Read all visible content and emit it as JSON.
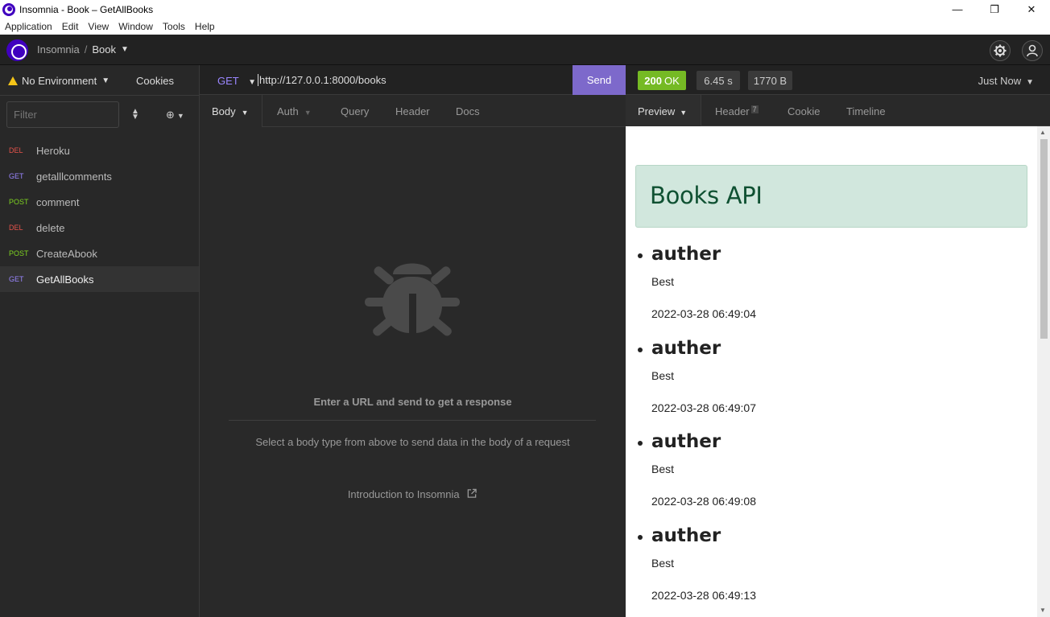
{
  "window": {
    "title": "Insomnia - Book – GetAllBooks",
    "controls": [
      "—",
      "❐",
      "✕"
    ]
  },
  "menu": [
    "Application",
    "Edit",
    "View",
    "Window",
    "Tools",
    "Help"
  ],
  "header": {
    "workspace": "Insomnia",
    "separator": "/",
    "collection": "Book"
  },
  "sidebar": {
    "environment": "No Environment",
    "cookies": "Cookies",
    "filter_placeholder": "Filter",
    "requests": [
      {
        "method": "DEL",
        "name": "Heroku"
      },
      {
        "method": "GET",
        "name": "getalllcomments"
      },
      {
        "method": "POST",
        "name": "comment"
      },
      {
        "method": "DEL",
        "name": "delete"
      },
      {
        "method": "POST",
        "name": "CreateAbook"
      },
      {
        "method": "GET",
        "name": "GetAllBooks"
      }
    ]
  },
  "request": {
    "method": "GET",
    "url": "http://127.0.0.1:8000/books",
    "send_label": "Send",
    "tabs": [
      "Body",
      "Auth",
      "Query",
      "Header",
      "Docs"
    ],
    "empty_title": "Enter a URL and send to get a response",
    "body_hint": "Select a body type from above to send data in the body of a request",
    "intro_link": "Introduction to Insomnia"
  },
  "response": {
    "status_code": "200",
    "status_text": "OK",
    "time": "6.45 s",
    "size": "1770 B",
    "history": "Just Now",
    "tabs": [
      "Preview",
      "Header",
      "Cookie",
      "Timeline"
    ],
    "header_count": "7",
    "preview": {
      "heading": "Books API",
      "books": [
        {
          "title": "auther",
          "author": "Best",
          "date": "2022-03-28 06:49:04"
        },
        {
          "title": "auther",
          "author": "Best",
          "date": "2022-03-28 06:49:07"
        },
        {
          "title": "auther",
          "author": "Best",
          "date": "2022-03-28 06:49:08"
        },
        {
          "title": "auther",
          "author": "Best",
          "date": "2022-03-28 06:49:13"
        }
      ]
    }
  },
  "colors": {
    "accent": "#4000bf",
    "send": "#7d69cb",
    "status_ok": "#75ba24",
    "method_get": "#9a86ff",
    "method_post": "#7ed321",
    "method_del": "#e5534b"
  }
}
